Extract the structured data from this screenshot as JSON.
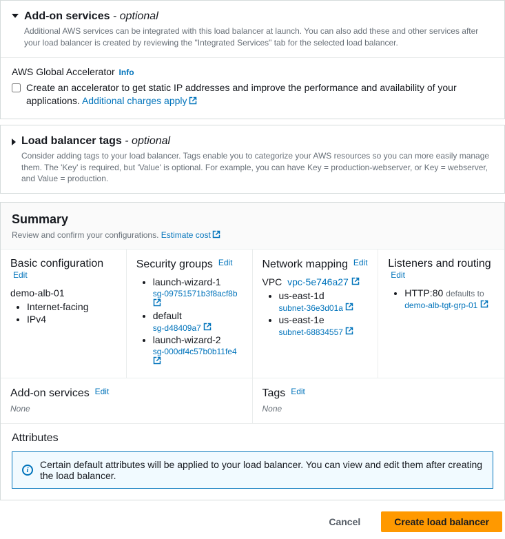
{
  "addon": {
    "title": "Add-on services",
    "optional": " - optional",
    "desc": "Additional AWS services can be integrated with this load balancer at launch. You can also add these and other services after your load balancer is created by reviewing the \"Integrated Services\" tab for the selected load balancer.",
    "accel_label": "AWS Global Accelerator",
    "info": "Info",
    "accel_desc": "Create an accelerator to get static IP addresses and improve the performance and availability of your applications. ",
    "charges": "Additional charges apply"
  },
  "tags": {
    "title": "Load balancer tags",
    "optional": " - optional",
    "desc": "Consider adding tags to your load balancer. Tags enable you to categorize your AWS resources so you can more easily manage them. The 'Key' is required, but 'Value' is optional. For example, you can have Key = production-webserver, or Key = webserver, and Value = production."
  },
  "summary": {
    "title": "Summary",
    "desc": "Review and confirm your configurations. ",
    "estimate": "Estimate cost"
  },
  "basic": {
    "title": "Basic configuration",
    "edit": "Edit",
    "name": "demo-alb-01",
    "items": [
      "Internet-facing",
      "IPv4"
    ]
  },
  "sg": {
    "title": "Security groups",
    "edit": "Edit",
    "items": [
      {
        "name": "launch-wizard-1",
        "id": "sg-09751571b3f8acf8b"
      },
      {
        "name": "default",
        "id": "sg-d48409a7"
      },
      {
        "name": "launch-wizard-2",
        "id": "sg-000df4c57b0b11fe4"
      }
    ]
  },
  "network": {
    "title": "Network mapping",
    "edit": "Edit",
    "vpc_label": "VPC",
    "vpc_id": "vpc-5e746a27",
    "subnets": [
      {
        "az": "us-east-1d",
        "id": "subnet-36e3d01a"
      },
      {
        "az": "us-east-1e",
        "id": "subnet-68834557"
      }
    ]
  },
  "listeners": {
    "title": "Listeners and routing",
    "edit": "Edit",
    "item": "HTTP:80",
    "defaults_to": "defaults to",
    "target": "demo-alb-tgt-grp-01"
  },
  "addon_summary": {
    "title": "Add-on services",
    "edit": "Edit",
    "none": "None"
  },
  "tags_summary": {
    "title": "Tags",
    "edit": "Edit",
    "none": "None"
  },
  "attributes": {
    "title": "Attributes",
    "info": "Certain default attributes will be applied to your load balancer. You can view and edit them after creating the load balancer."
  },
  "footer": {
    "cancel": "Cancel",
    "create": "Create load balancer"
  }
}
